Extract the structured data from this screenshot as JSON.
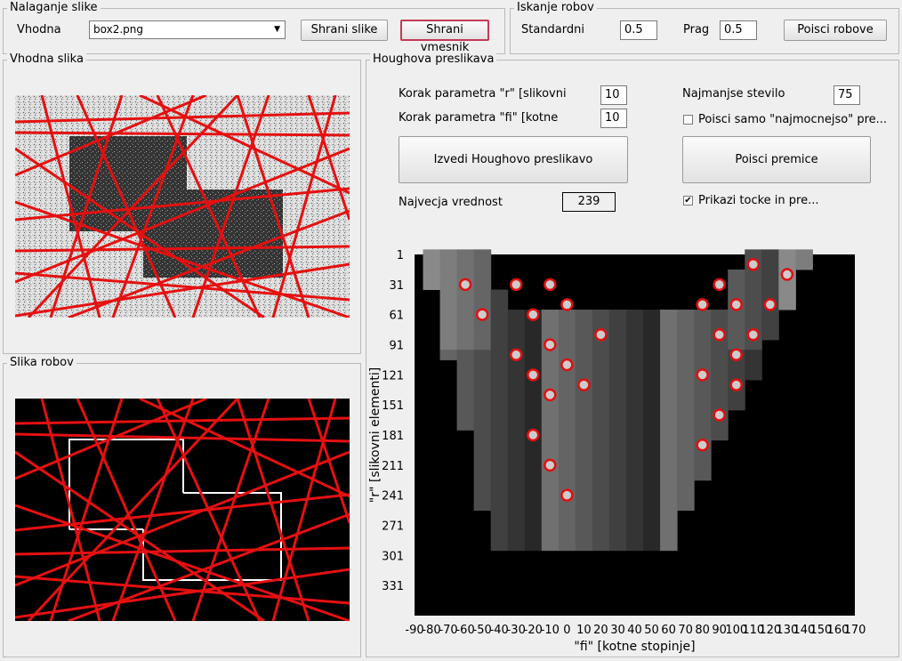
{
  "load_group": {
    "title": "Nalaganje slike",
    "input_label": "Vhodna",
    "file_value": "box2.png",
    "save_images": "Shrani slike",
    "save_interface": "Shrani vmesnik"
  },
  "edge_group": {
    "title": "Iskanje robov",
    "std_label": "Standardni",
    "std_value": "0.5",
    "thr_label": "Prag",
    "thr_value": "0.5",
    "find_edges": "Poisci robove"
  },
  "input_panel": {
    "title": "Vhodna slika"
  },
  "edges_panel": {
    "title": "Slika robov"
  },
  "hough_group": {
    "title": "Houghova preslikava",
    "r_step_label": "Korak parametra \"r\" [slikovni",
    "r_step_value": "10",
    "fi_step_label": "Korak parametra \"fi\" [kotne",
    "fi_step_value": "10",
    "min_count_label": "Najmanjse stevilo",
    "min_count_value": "75",
    "strongest_label": "Poisci samo \"najmocnejso\" pre...",
    "do_hough": "Izvedi Houghovo preslikavo",
    "find_lines": "Poisci premice",
    "max_label": "Najvecja vrednost",
    "max_value": "239",
    "show_points_label": "Prikazi tocke in pre...",
    "strongest_checked": "",
    "show_points_checked": "✔"
  },
  "chart_data": {
    "type": "heatmap",
    "title": "",
    "xlabel": "\"fi\"   [kotne stopinje]",
    "ylabel": "\"r\"   [slikovni elementi]",
    "x_ticks": [
      "-90",
      "-80",
      "-70",
      "-60",
      "-50",
      "-40",
      "-30",
      "-20",
      "-10",
      "0",
      "10",
      "20",
      "30",
      "40",
      "50",
      "60",
      "70",
      "80",
      "90",
      "100",
      "110",
      "120",
      "130",
      "140",
      "150",
      "160",
      "170"
    ],
    "y_ticks": [
      "1",
      "31",
      "61",
      "91",
      "121",
      "151",
      "181",
      "211",
      "241",
      "271",
      "301",
      "331"
    ],
    "xlim": [
      -90,
      170
    ],
    "ylim": [
      1,
      361
    ],
    "accumulator_shape": "V-shaped grey band on black background",
    "peaks": [
      {
        "fi": -60,
        "r": 31
      },
      {
        "fi": -30,
        "r": 31
      },
      {
        "fi": -10,
        "r": 31
      },
      {
        "fi": -50,
        "r": 61
      },
      {
        "fi": -20,
        "r": 61
      },
      {
        "fi": 0,
        "r": 51
      },
      {
        "fi": 20,
        "r": 81
      },
      {
        "fi": -10,
        "r": 91
      },
      {
        "fi": -30,
        "r": 101
      },
      {
        "fi": 0,
        "r": 111
      },
      {
        "fi": -20,
        "r": 121
      },
      {
        "fi": 10,
        "r": 131
      },
      {
        "fi": -10,
        "r": 141
      },
      {
        "fi": -20,
        "r": 181
      },
      {
        "fi": -10,
        "r": 211
      },
      {
        "fi": 0,
        "r": 241
      },
      {
        "fi": 110,
        "r": 11
      },
      {
        "fi": 130,
        "r": 21
      },
      {
        "fi": 90,
        "r": 31
      },
      {
        "fi": 80,
        "r": 51
      },
      {
        "fi": 100,
        "r": 51
      },
      {
        "fi": 120,
        "r": 51
      },
      {
        "fi": 90,
        "r": 81
      },
      {
        "fi": 110,
        "r": 81
      },
      {
        "fi": 100,
        "r": 101
      },
      {
        "fi": 80,
        "r": 121
      },
      {
        "fi": 100,
        "r": 131
      },
      {
        "fi": 90,
        "r": 161
      },
      {
        "fi": 80,
        "r": 191
      }
    ],
    "peak_color": "#e01010"
  },
  "colors": {
    "line": "#e51010",
    "background": "#efefef"
  }
}
